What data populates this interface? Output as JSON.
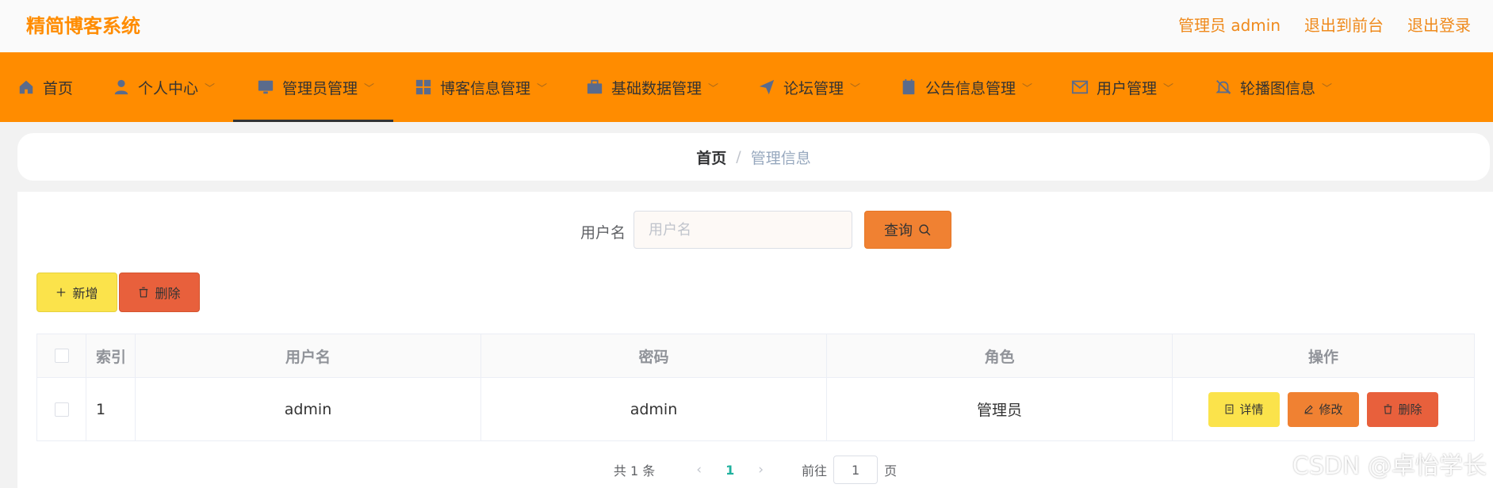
{
  "header": {
    "brand": "精简博客系统",
    "links": [
      "管理员 admin",
      "退出到前台",
      "退出登录"
    ]
  },
  "nav": {
    "items": [
      {
        "label": "首页",
        "icon": "home-icon"
      },
      {
        "label": "个人中心",
        "icon": "user-icon"
      },
      {
        "label": "管理员管理",
        "icon": "monitor-icon"
      },
      {
        "label": "博客信息管理",
        "icon": "grid-icon"
      },
      {
        "label": "基础数据管理",
        "icon": "briefcase-icon"
      },
      {
        "label": "论坛管理",
        "icon": "send-icon"
      },
      {
        "label": "公告信息管理",
        "icon": "notebook-icon"
      },
      {
        "label": "用户管理",
        "icon": "message-icon"
      },
      {
        "label": "轮播图信息",
        "icon": "bell-off-icon"
      }
    ],
    "active_index": 2
  },
  "breadcrumb": {
    "home": "首页",
    "separator": "/",
    "current": "管理信息"
  },
  "search": {
    "label": "用户名",
    "placeholder": "用户名",
    "value": "",
    "button": "查询"
  },
  "actions": {
    "add": "新增",
    "delete": "删除"
  },
  "table": {
    "columns": [
      "索引",
      "用户名",
      "密码",
      "角色",
      "操作"
    ],
    "rows": [
      {
        "index": "1",
        "username": "admin",
        "password": "admin",
        "role": "管理员"
      }
    ],
    "row_actions": {
      "detail": "详情",
      "edit": "修改",
      "delete": "删除"
    }
  },
  "pagination": {
    "total_text": "共 1 条",
    "current_page": "1",
    "goto_label": "前往",
    "goto_value": "1",
    "page_suffix": "页"
  },
  "watermark": "CSDN @卓怡学长",
  "colors": {
    "brand": "#ff8c00",
    "nav_bg": "#ff8c00",
    "query_button": "#f08132",
    "add_button": "#fbe34b",
    "delete_button": "#e8603c",
    "active_page": "#1fb19e"
  }
}
